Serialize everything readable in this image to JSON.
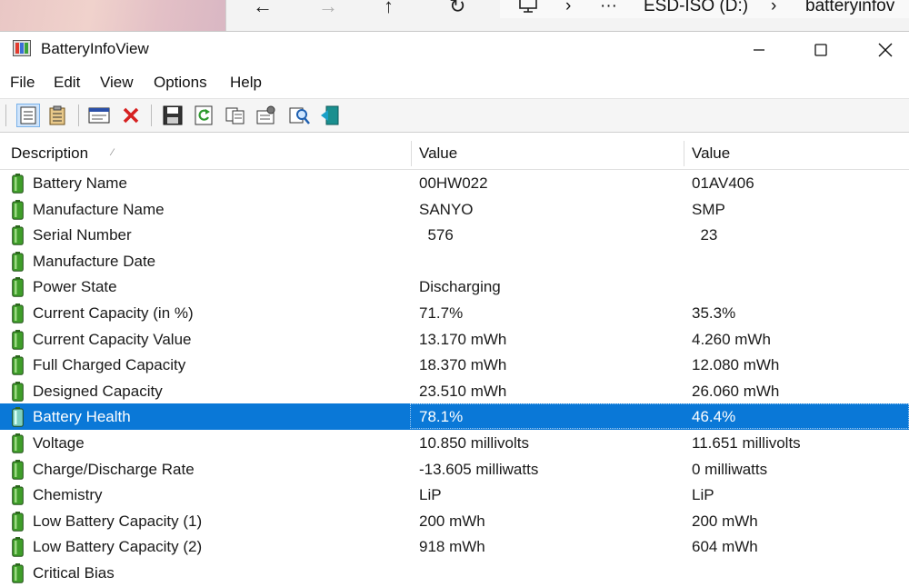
{
  "explorer": {
    "breadcrumb": [
      "ESD-ISO (D:)",
      "batteryinfov"
    ],
    "more": "···"
  },
  "window": {
    "title": "BatteryInfoView"
  },
  "menu": [
    "File",
    "Edit",
    "View",
    "Options",
    "Help"
  ],
  "toolbar": [
    {
      "name": "toolbar-properties-view-button",
      "icon": "property-list-icon",
      "active": true
    },
    {
      "name": "toolbar-report-view-button",
      "icon": "clipboard-icon"
    },
    {
      "name": "toolbar-html-report-button",
      "icon": "window-icon"
    },
    {
      "name": "toolbar-delete-button",
      "icon": "red-x-icon"
    },
    {
      "name": "toolbar-save-button",
      "icon": "floppy-disk-icon"
    },
    {
      "name": "toolbar-refresh-button",
      "icon": "refresh-icon"
    },
    {
      "name": "toolbar-copy-button",
      "icon": "copy-icon"
    },
    {
      "name": "toolbar-properties-button",
      "icon": "properties-icon"
    },
    {
      "name": "toolbar-find-button",
      "icon": "find-icon"
    },
    {
      "name": "toolbar-exit-button",
      "icon": "exit-icon"
    }
  ],
  "columns": [
    "Description",
    "Value",
    "Value"
  ],
  "rows": [
    {
      "desc": "Battery Name",
      "v1": "00HW022",
      "v2": "01AV406"
    },
    {
      "desc": "Manufacture Name",
      "v1": "SANYO",
      "v2": "SMP"
    },
    {
      "desc": "Serial Number",
      "v1": "  576",
      "v2": "  23"
    },
    {
      "desc": "Manufacture Date",
      "v1": "",
      "v2": ""
    },
    {
      "desc": "Power State",
      "v1": "Discharging",
      "v2": ""
    },
    {
      "desc": "Current Capacity (in %)",
      "v1": "71.7%",
      "v2": "35.3%"
    },
    {
      "desc": "Current Capacity Value",
      "v1": "13.170 mWh",
      "v2": "4.260 mWh"
    },
    {
      "desc": "Full Charged Capacity",
      "v1": "18.370 mWh",
      "v2": "12.080 mWh"
    },
    {
      "desc": "Designed Capacity",
      "v1": "23.510 mWh",
      "v2": "26.060 mWh"
    },
    {
      "desc": "Battery Health",
      "v1": "78.1%",
      "v2": "46.4%",
      "selected": true
    },
    {
      "desc": "Voltage",
      "v1": "10.850 millivolts",
      "v2": "11.651 millivolts"
    },
    {
      "desc": "Charge/Discharge Rate",
      "v1": "-13.605 milliwatts",
      "v2": "0 milliwatts"
    },
    {
      "desc": "Chemistry",
      "v1": "LiP",
      "v2": "LiP"
    },
    {
      "desc": "Low Battery Capacity (1)",
      "v1": "200 mWh",
      "v2": "200 mWh"
    },
    {
      "desc": "Low Battery Capacity (2)",
      "v1": "918 mWh",
      "v2": "604 mWh"
    },
    {
      "desc": "Critical Bias",
      "v1": "",
      "v2": ""
    }
  ],
  "colors": {
    "selection": "#0a78d7",
    "battery_green": "#3f9e2a"
  }
}
